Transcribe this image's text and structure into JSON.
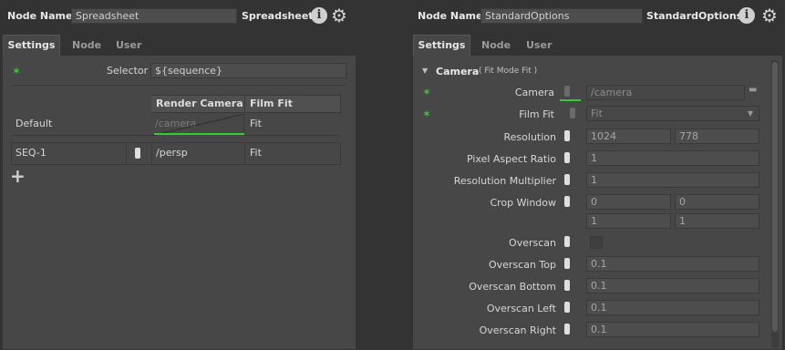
{
  "left": {
    "header": {
      "node_name_label": "Node Name",
      "node_name_value": "Spreadsheet",
      "node_type": "Spreadsheet",
      "info_glyph": "i",
      "gear_glyph": "⚙"
    },
    "tabs": [
      "Settings",
      "Node",
      "User"
    ],
    "selector": {
      "label": "Selector",
      "value": "${sequence}"
    },
    "table": {
      "columns": [
        "Render Camera",
        "Film Fit"
      ],
      "default_row": {
        "name": "Default",
        "render_camera": "/camera",
        "film_fit": "Fit"
      },
      "rows": [
        {
          "name": "SEQ-1",
          "render_camera": "/persp",
          "film_fit": "Fit"
        }
      ],
      "add_glyph": "+"
    },
    "marker_glyph": "✶"
  },
  "right": {
    "header": {
      "node_name_label": "Node Name",
      "node_name_value": "StandardOptions",
      "node_type": "StandardOptions",
      "info_glyph": "i",
      "gear_glyph": "⚙"
    },
    "tabs": [
      "Settings",
      "Node",
      "User"
    ],
    "section": {
      "title": "Camera",
      "summary": "( Fit Mode Fit )",
      "arrow": "▼"
    },
    "marker_glyph": "✶",
    "rows": {
      "camera": {
        "label": "Camera",
        "value": "/camera",
        "folder_glyph": "▬"
      },
      "film_fit": {
        "label": "Film Fit",
        "value": "Fit",
        "dropdown_glyph": "▼"
      },
      "resolution": {
        "label": "Resolution",
        "x": "1024",
        "y": "778"
      },
      "pixel_aspect_ratio": {
        "label": "Pixel Aspect Ratio",
        "value": "1"
      },
      "resolution_multiplier": {
        "label": "Resolution Multiplier",
        "value": "1"
      },
      "crop_window": {
        "label": "Crop Window",
        "min_x": "0",
        "min_y": "0",
        "max_x": "1",
        "max_y": "1"
      },
      "overscan": {
        "label": "Overscan"
      },
      "overscan_top": {
        "label": "Overscan Top",
        "value": "0.1"
      },
      "overscan_bottom": {
        "label": "Overscan Bottom",
        "value": "0.1"
      },
      "overscan_left": {
        "label": "Overscan Left",
        "value": "0.1"
      },
      "overscan_right": {
        "label": "Overscan Right",
        "value": "0.1"
      }
    }
  }
}
